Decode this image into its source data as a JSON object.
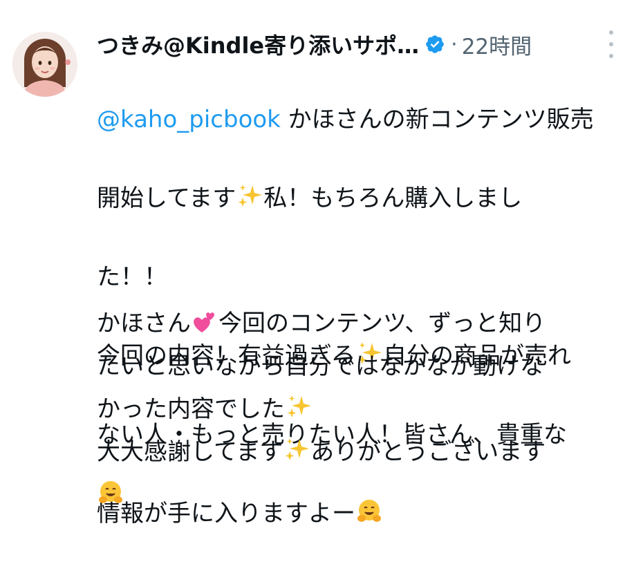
{
  "post": {
    "author": {
      "display_name": "つきみ@Kindle寄り添いサポ…",
      "verified": true
    },
    "separator": "·",
    "timestamp": "22時間",
    "more_icon": "more-vertical-icon",
    "mention": "@kaho_picbook",
    "lines_p1": [
      " かほさんの新コンテンツ販売",
      "開始してます",
      "私！もちろん購入しまし",
      "た！！",
      "今回の内容！有益過ぎる",
      "自分の商品が売れ",
      "ない人・もっと売りたい人！皆さん、貴重な",
      "情報が手に入りますよー"
    ],
    "lines_p2": [
      "かほさん",
      "今回のコンテンツ、ずっと知り",
      "たいと思いながら自分ではなかなか動けな",
      "かった内容でした",
      "大大感謝してます",
      "ありがとうございます"
    ],
    "emojis": {
      "sparkles": "sparkles-icon",
      "hugging": "hugging-face-icon",
      "two_hearts": "two-hearts-icon"
    },
    "colors": {
      "link": "#1d9bf0",
      "text": "#0f1419",
      "muted": "#536471",
      "verified": "#1d9bf0"
    }
  }
}
